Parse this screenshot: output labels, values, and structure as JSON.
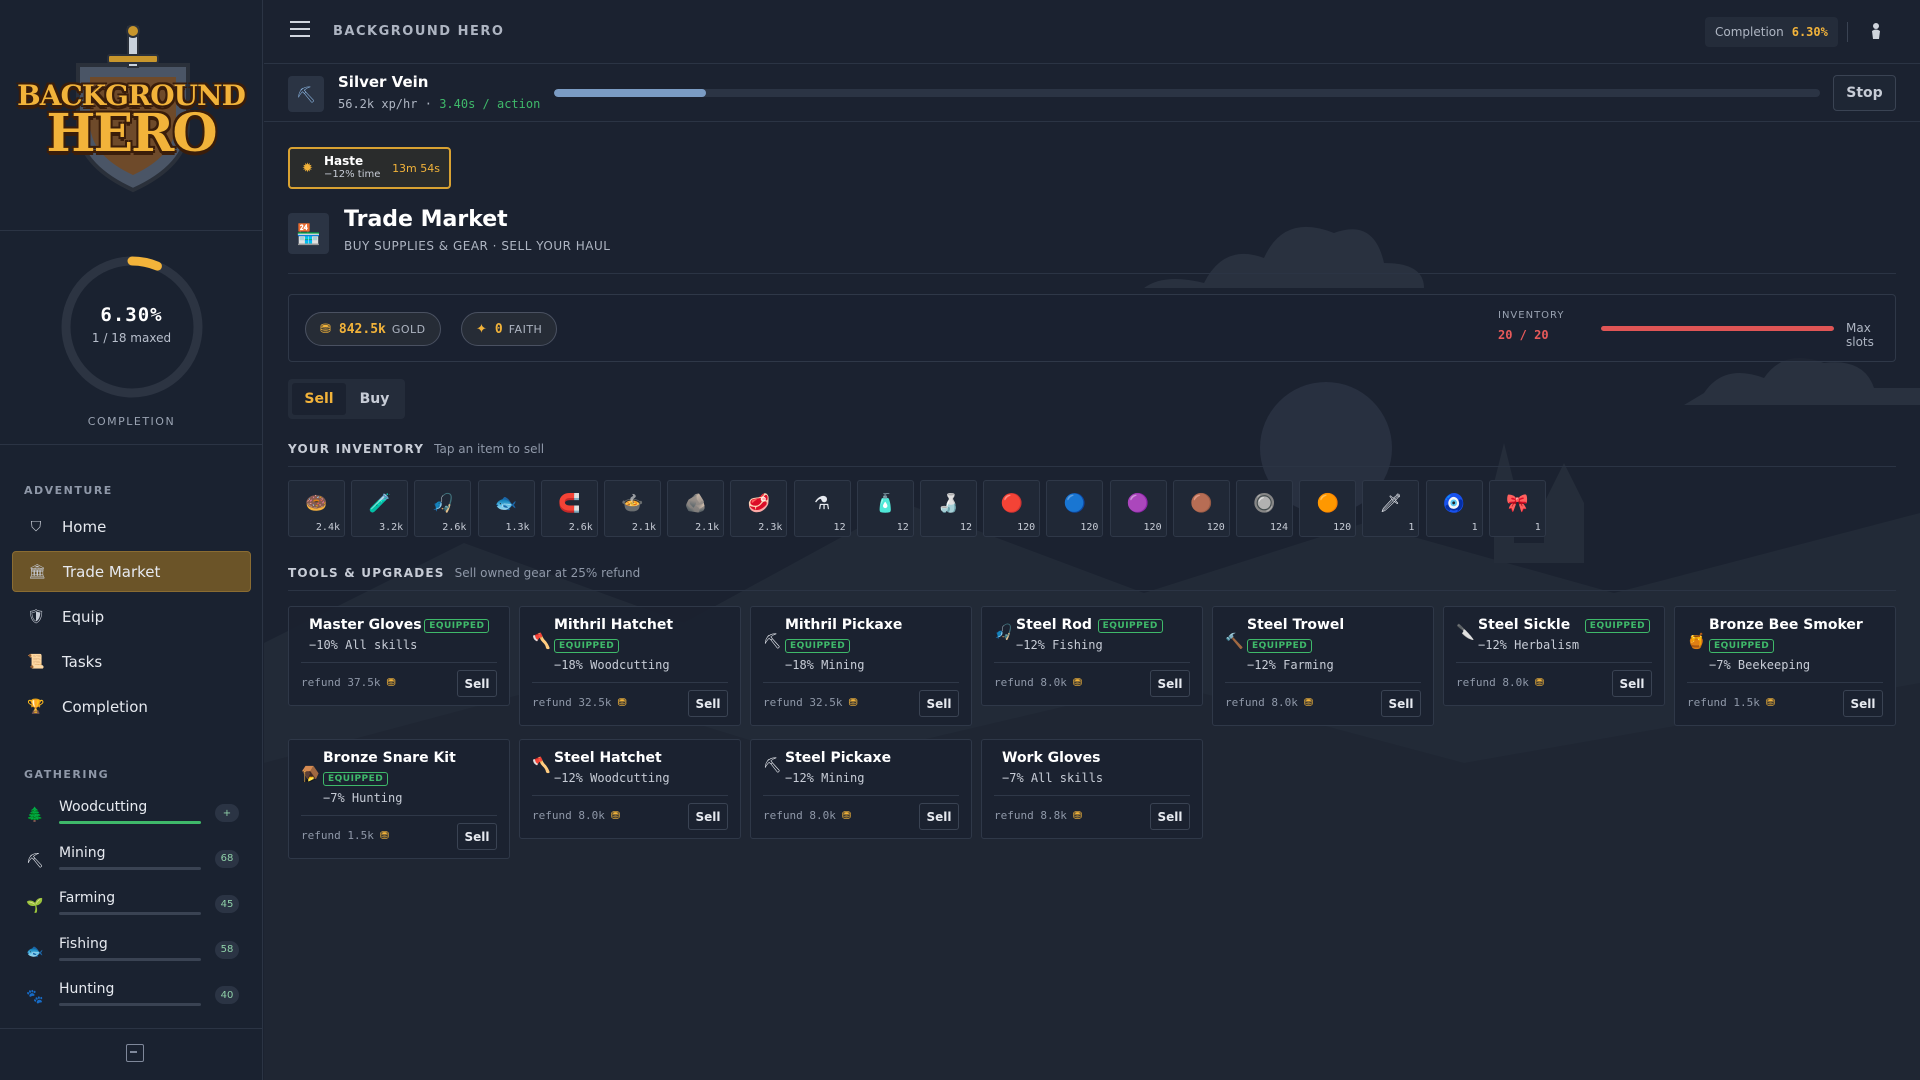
{
  "app": {
    "title": "BACKGROUND HERO",
    "logo_line1": "BACKGROUND",
    "logo_line2": "HERO"
  },
  "completion": {
    "percent_text": "6.30%",
    "maxed_text": "1 / 18 maxed",
    "label": "COMPLETION",
    "fraction": 0.063
  },
  "topbar": {
    "completion_label": "Completion",
    "completion_value": "6.30%"
  },
  "sidebar": {
    "adventure_heading": "ADVENTURE",
    "nav": [
      {
        "label": "Home",
        "icon": "shield-icon"
      },
      {
        "label": "Trade Market",
        "icon": "bank-icon",
        "active": true
      },
      {
        "label": "Equip",
        "icon": "armor-icon"
      },
      {
        "label": "Tasks",
        "icon": "scroll-icon"
      },
      {
        "label": "Completion",
        "icon": "trophy-icon"
      }
    ],
    "gathering_heading": "GATHERING",
    "skills": [
      {
        "name": "Woodcutting",
        "level": "+",
        "icon": "tree-icon",
        "progress": 1.0
      },
      {
        "name": "Mining",
        "level": "68",
        "icon": "pickaxe-icon",
        "progress": 0.0
      },
      {
        "name": "Farming",
        "level": "45",
        "icon": "sprout-icon",
        "progress": 0.0
      },
      {
        "name": "Fishing",
        "level": "58",
        "icon": "fish-icon",
        "progress": 0.0
      },
      {
        "name": "Hunting",
        "level": "40",
        "icon": "paw-icon",
        "progress": 0.0
      }
    ]
  },
  "activity": {
    "name": "Silver Vein",
    "xp_rate": "56.2k xp/hr",
    "separator": "·",
    "action_time": "3.40s / action",
    "progress": 0.12,
    "stop_label": "Stop"
  },
  "buff": {
    "name": "Haste",
    "effect": "−12% time",
    "remaining": "13m 54s"
  },
  "page": {
    "title": "Trade Market",
    "subtitle": "BUY SUPPLIES & GEAR · SELL YOUR HAUL"
  },
  "wallet": {
    "gold_value": "842.5k",
    "gold_unit": "GOLD",
    "faith_value": "0",
    "faith_unit": "FAITH",
    "inventory_label": "INVENTORY",
    "inventory_count": "20 / 20",
    "inventory_fraction": 1.0,
    "inventory_note": "Max slots"
  },
  "tabs": {
    "sell": "Sell",
    "buy": "Buy"
  },
  "inventory": {
    "heading": "YOUR INVENTORY",
    "hint": "Tap an item to sell",
    "items": [
      {
        "icon": "🍩",
        "qty": "2.4k"
      },
      {
        "icon": "🧪",
        "qty": "3.2k"
      },
      {
        "icon": "🎣",
        "qty": "2.6k"
      },
      {
        "icon": "🐟",
        "qty": "1.3k"
      },
      {
        "icon": "🧲",
        "qty": "2.6k"
      },
      {
        "icon": "🍲",
        "qty": "2.1k"
      },
      {
        "icon": "🪨",
        "qty": "2.1k"
      },
      {
        "icon": "🥩",
        "qty": "2.3k"
      },
      {
        "icon": "⚗",
        "qty": "12"
      },
      {
        "icon": "🧴",
        "qty": "12"
      },
      {
        "icon": "🍶",
        "qty": "12"
      },
      {
        "icon": "🔴",
        "qty": "120"
      },
      {
        "icon": "🔵",
        "qty": "120"
      },
      {
        "icon": "🟣",
        "qty": "120"
      },
      {
        "icon": "🟤",
        "qty": "120"
      },
      {
        "icon": "🔘",
        "qty": "124"
      },
      {
        "icon": "🟠",
        "qty": "120"
      },
      {
        "icon": "🗡",
        "qty": "1"
      },
      {
        "icon": "🧿",
        "qty": "1"
      },
      {
        "icon": "🎀",
        "qty": "1"
      }
    ]
  },
  "tools": {
    "heading": "TOOLS & UPGRADES",
    "hint": "Sell owned gear at 25% refund",
    "equipped_label": "EQUIPPED",
    "sell_label": "Sell",
    "refund_prefix": "refund",
    "cards": [
      {
        "name": "Master Gloves",
        "equipped": true,
        "badge_inline": true,
        "effect": "−10% All skills",
        "refund": "37.5k",
        "icon": ""
      },
      {
        "name": "Mithril Hatchet",
        "equipped": true,
        "badge_inline": false,
        "effect": "−18% Woodcutting",
        "refund": "32.5k",
        "icon": "🪓"
      },
      {
        "name": "Mithril Pickaxe",
        "equipped": true,
        "badge_inline": false,
        "effect": "−18% Mining",
        "refund": "32.5k",
        "icon": "⛏"
      },
      {
        "name": "Steel Rod",
        "equipped": true,
        "badge_inline": true,
        "effect": "−12% Fishing",
        "refund": "8.0k",
        "icon": "🎣"
      },
      {
        "name": "Steel Trowel",
        "equipped": true,
        "badge_inline": false,
        "effect": "−12% Farming",
        "refund": "8.0k",
        "icon": "🔨"
      },
      {
        "name": "Steel Sickle",
        "equipped": true,
        "badge_inline": true,
        "effect": "−12% Herbalism",
        "refund": "8.0k",
        "icon": "🔪"
      },
      {
        "name": "Bronze Bee Smoker",
        "equipped": true,
        "badge_inline": false,
        "effect": "−7% Beekeeping",
        "refund": "1.5k",
        "icon": "🍯"
      },
      {
        "name": "Bronze Snare Kit",
        "equipped": true,
        "badge_inline": false,
        "effect": "−7% Hunting",
        "refund": "1.5k",
        "icon": "🪤"
      },
      {
        "name": "Steel Hatchet",
        "equipped": false,
        "badge_inline": false,
        "effect": "−12% Woodcutting",
        "refund": "8.0k",
        "icon": "🪓"
      },
      {
        "name": "Steel Pickaxe",
        "equipped": false,
        "badge_inline": false,
        "effect": "−12% Mining",
        "refund": "8.0k",
        "icon": "⛏"
      },
      {
        "name": "Work Gloves",
        "equipped": false,
        "badge_inline": false,
        "effect": "−7% All skills",
        "refund": "8.8k",
        "icon": ""
      }
    ]
  }
}
